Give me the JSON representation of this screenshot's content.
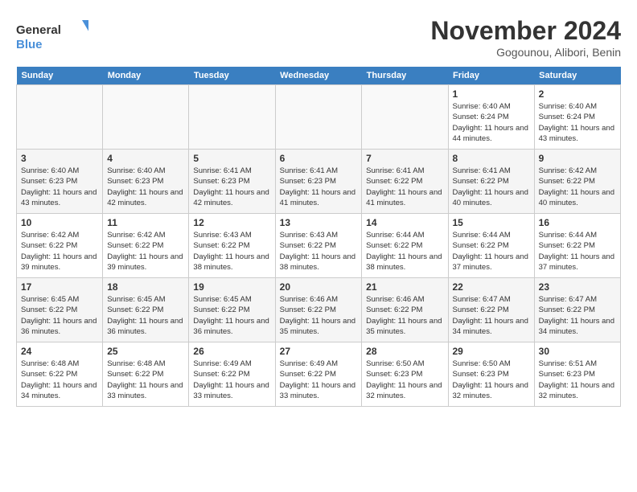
{
  "logo": {
    "line1": "General",
    "line2": "Blue"
  },
  "title": "November 2024",
  "subtitle": "Gogounou, Alibori, Benin",
  "weekdays": [
    "Sunday",
    "Monday",
    "Tuesday",
    "Wednesday",
    "Thursday",
    "Friday",
    "Saturday"
  ],
  "weeks": [
    [
      {
        "day": "",
        "info": ""
      },
      {
        "day": "",
        "info": ""
      },
      {
        "day": "",
        "info": ""
      },
      {
        "day": "",
        "info": ""
      },
      {
        "day": "",
        "info": ""
      },
      {
        "day": "1",
        "info": "Sunrise: 6:40 AM\nSunset: 6:24 PM\nDaylight: 11 hours and 44 minutes."
      },
      {
        "day": "2",
        "info": "Sunrise: 6:40 AM\nSunset: 6:24 PM\nDaylight: 11 hours and 43 minutes."
      }
    ],
    [
      {
        "day": "3",
        "info": "Sunrise: 6:40 AM\nSunset: 6:23 PM\nDaylight: 11 hours and 43 minutes."
      },
      {
        "day": "4",
        "info": "Sunrise: 6:40 AM\nSunset: 6:23 PM\nDaylight: 11 hours and 42 minutes."
      },
      {
        "day": "5",
        "info": "Sunrise: 6:41 AM\nSunset: 6:23 PM\nDaylight: 11 hours and 42 minutes."
      },
      {
        "day": "6",
        "info": "Sunrise: 6:41 AM\nSunset: 6:23 PM\nDaylight: 11 hours and 41 minutes."
      },
      {
        "day": "7",
        "info": "Sunrise: 6:41 AM\nSunset: 6:22 PM\nDaylight: 11 hours and 41 minutes."
      },
      {
        "day": "8",
        "info": "Sunrise: 6:41 AM\nSunset: 6:22 PM\nDaylight: 11 hours and 40 minutes."
      },
      {
        "day": "9",
        "info": "Sunrise: 6:42 AM\nSunset: 6:22 PM\nDaylight: 11 hours and 40 minutes."
      }
    ],
    [
      {
        "day": "10",
        "info": "Sunrise: 6:42 AM\nSunset: 6:22 PM\nDaylight: 11 hours and 39 minutes."
      },
      {
        "day": "11",
        "info": "Sunrise: 6:42 AM\nSunset: 6:22 PM\nDaylight: 11 hours and 39 minutes."
      },
      {
        "day": "12",
        "info": "Sunrise: 6:43 AM\nSunset: 6:22 PM\nDaylight: 11 hours and 38 minutes."
      },
      {
        "day": "13",
        "info": "Sunrise: 6:43 AM\nSunset: 6:22 PM\nDaylight: 11 hours and 38 minutes."
      },
      {
        "day": "14",
        "info": "Sunrise: 6:44 AM\nSunset: 6:22 PM\nDaylight: 11 hours and 38 minutes."
      },
      {
        "day": "15",
        "info": "Sunrise: 6:44 AM\nSunset: 6:22 PM\nDaylight: 11 hours and 37 minutes."
      },
      {
        "day": "16",
        "info": "Sunrise: 6:44 AM\nSunset: 6:22 PM\nDaylight: 11 hours and 37 minutes."
      }
    ],
    [
      {
        "day": "17",
        "info": "Sunrise: 6:45 AM\nSunset: 6:22 PM\nDaylight: 11 hours and 36 minutes."
      },
      {
        "day": "18",
        "info": "Sunrise: 6:45 AM\nSunset: 6:22 PM\nDaylight: 11 hours and 36 minutes."
      },
      {
        "day": "19",
        "info": "Sunrise: 6:45 AM\nSunset: 6:22 PM\nDaylight: 11 hours and 36 minutes."
      },
      {
        "day": "20",
        "info": "Sunrise: 6:46 AM\nSunset: 6:22 PM\nDaylight: 11 hours and 35 minutes."
      },
      {
        "day": "21",
        "info": "Sunrise: 6:46 AM\nSunset: 6:22 PM\nDaylight: 11 hours and 35 minutes."
      },
      {
        "day": "22",
        "info": "Sunrise: 6:47 AM\nSunset: 6:22 PM\nDaylight: 11 hours and 34 minutes."
      },
      {
        "day": "23",
        "info": "Sunrise: 6:47 AM\nSunset: 6:22 PM\nDaylight: 11 hours and 34 minutes."
      }
    ],
    [
      {
        "day": "24",
        "info": "Sunrise: 6:48 AM\nSunset: 6:22 PM\nDaylight: 11 hours and 34 minutes."
      },
      {
        "day": "25",
        "info": "Sunrise: 6:48 AM\nSunset: 6:22 PM\nDaylight: 11 hours and 33 minutes."
      },
      {
        "day": "26",
        "info": "Sunrise: 6:49 AM\nSunset: 6:22 PM\nDaylight: 11 hours and 33 minutes."
      },
      {
        "day": "27",
        "info": "Sunrise: 6:49 AM\nSunset: 6:22 PM\nDaylight: 11 hours and 33 minutes."
      },
      {
        "day": "28",
        "info": "Sunrise: 6:50 AM\nSunset: 6:23 PM\nDaylight: 11 hours and 32 minutes."
      },
      {
        "day": "29",
        "info": "Sunrise: 6:50 AM\nSunset: 6:23 PM\nDaylight: 11 hours and 32 minutes."
      },
      {
        "day": "30",
        "info": "Sunrise: 6:51 AM\nSunset: 6:23 PM\nDaylight: 11 hours and 32 minutes."
      }
    ]
  ]
}
